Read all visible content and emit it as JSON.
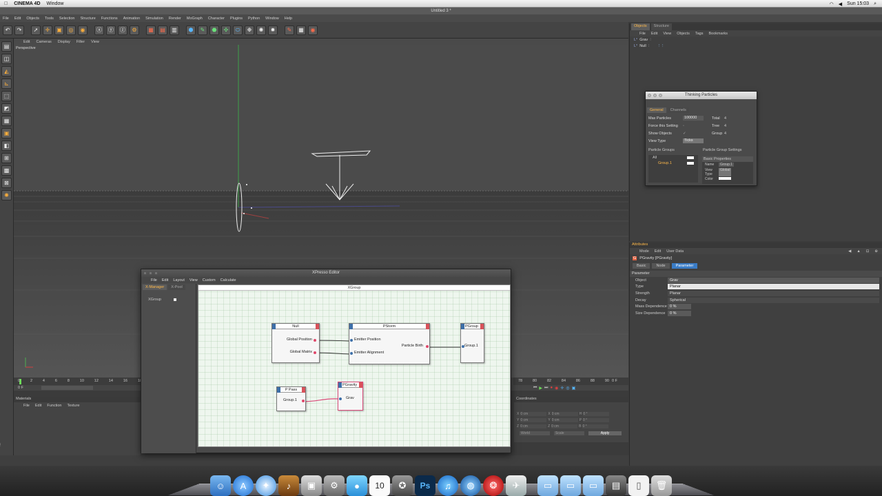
{
  "macbar": {
    "app": "CINEMA 4D",
    "menus": [
      "Window"
    ],
    "clock": "Sun 15:03"
  },
  "window_title": "Untitled 3 *",
  "c4d_menu": [
    "File",
    "Edit",
    "Objects",
    "Tools",
    "Selection",
    "Structure",
    "Functions",
    "Animation",
    "Simulation",
    "Render",
    "MoGraph",
    "Character",
    "Plugins",
    "Python",
    "Window",
    "Help"
  ],
  "viewport": {
    "menu": [
      "Edit",
      "Cameras",
      "Display",
      "Filter",
      "View"
    ],
    "label": "Perspective"
  },
  "object_manager": {
    "tabs": [
      "Objects",
      "Structure"
    ],
    "menu": [
      "File",
      "Edit",
      "View",
      "Objects",
      "Tags",
      "Bookmarks"
    ],
    "objects": [
      {
        "name": "Grav"
      },
      {
        "name": "Null"
      }
    ]
  },
  "thinking_particles": {
    "title": "Thinking Particles",
    "tabs": [
      "General",
      "Channels"
    ],
    "max_particles_label": "Max Particles",
    "max_particles_value": "100000",
    "total_label": "Total",
    "total_value": "4",
    "force_label": "Force this Setting",
    "tree_label": "Tree",
    "tree_value": "4",
    "show_objects_label": "Show Objects",
    "group_label": "Group",
    "group_value": "4",
    "view_type_label": "View Type",
    "view_type_value": "Ticks",
    "particle_groups_label": "Particle Groups",
    "group_settings_label": "Particle Group Settings",
    "tree_all": "All",
    "tree_group1": "Group.1",
    "basic_props": "Basic Properties",
    "name_label": "Name",
    "name_value": "Group.1",
    "view_type2_label": "View Type",
    "view_type2_value": "Global",
    "color_label": "Color"
  },
  "attributes": {
    "header": "Attributes",
    "menu": [
      "Mode",
      "Edit",
      "User Data"
    ],
    "object_label": "PGravity [PGravity]",
    "tabs": [
      "Basic",
      "Node",
      "Parameter"
    ],
    "section": "Parameter",
    "object_field_label": "Object",
    "object_field_value": "Grav",
    "type_label": "Type",
    "type_value": "Planar",
    "strength_label": "Strength",
    "strength_option": "Planar",
    "decay_label": "Decay",
    "decay_option": "Spherical",
    "mass_label": "Mass Dependence",
    "mass_value": "0 %",
    "size_label": "Size Dependence",
    "size_value": "0 %"
  },
  "xpresso": {
    "title": "XPresso Editor",
    "menu": [
      "File",
      "Edit",
      "Layout",
      "View",
      "Custom",
      "Calculate"
    ],
    "left_tabs": [
      "X-Manager",
      "X-Pool"
    ],
    "left_item": "XGroup",
    "group_bar": "XGroup",
    "nodes": {
      "null_title": "Null",
      "null_port1": "Global Position",
      "null_port2": "Global Matrix",
      "pstorm_title": "PStorm",
      "pstorm_in1": "Emitter Position",
      "pstorm_in2": "Emitter Alignment",
      "pstorm_out": "Particle Birth",
      "pgroup_title": "PGroup",
      "pgroup_port": "Group.1",
      "ppass_title": "P Pass",
      "ppass_port": "Group.1",
      "pgravity_title": "PGravity",
      "pgravity_port": "Grav"
    }
  },
  "timeline": {
    "ticks_left": [
      "0",
      "2",
      "4",
      "6",
      "8",
      "10",
      "12",
      "14",
      "16",
      "18"
    ],
    "ticks_right": [
      "78",
      "80",
      "82",
      "84",
      "86",
      "88",
      "90"
    ],
    "frame_start": "0 F",
    "frame_end": "0 F"
  },
  "materials": {
    "header": "Materials",
    "menu": [
      "File",
      "Edit",
      "Function",
      "Texture"
    ]
  },
  "coordinates": {
    "header": "Coordinates",
    "apply": "Apply",
    "rows": [
      {
        "a": "X",
        "av": "0 cm",
        "b": "X",
        "bv": "0 cm",
        "c": "H",
        "cv": "0 °"
      },
      {
        "a": "Y",
        "av": "0 cm",
        "b": "Y",
        "bv": "0 cm",
        "c": "P",
        "cv": "0 °"
      },
      {
        "a": "Z",
        "av": "0 cm",
        "b": "Z",
        "bv": "0 cm",
        "c": "B",
        "cv": "0 °"
      }
    ],
    "world": "World",
    "scale": "Scale"
  },
  "dock_items": [
    "finder-icon",
    "appstore-icon",
    "safari-icon",
    "garageband-icon",
    "photobooth-icon",
    "sysprefs-icon",
    "messages-icon",
    "calendar-icon",
    "imovie-icon",
    "photoshop-icon",
    "itunes-icon",
    "network-icon",
    "cinema4d-icon",
    "preview-icon",
    "folder-icon",
    "folder-icon-2",
    "folder-icon-3",
    "desktop-icon",
    "document-icon",
    "trash-icon"
  ],
  "calendar_day": "10",
  "photoshop_label": "Ps",
  "colors": {
    "accent": "#ffb94a",
    "active_tab": "#3a7cc6",
    "canvas_bg": "#eef6ee"
  }
}
